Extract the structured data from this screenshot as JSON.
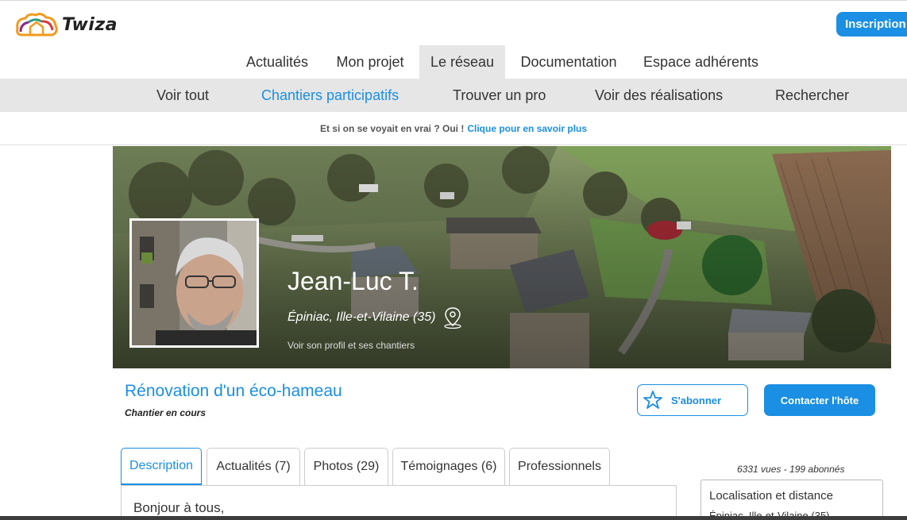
{
  "header": {
    "logo_text": "Twiza",
    "signup_label": "Inscription"
  },
  "main_nav": [
    {
      "label": "Actualités",
      "active": false
    },
    {
      "label": "Mon projet",
      "active": false
    },
    {
      "label": "Le réseau",
      "active": true
    },
    {
      "label": "Documentation",
      "active": false
    },
    {
      "label": "Espace adhérents",
      "active": false
    }
  ],
  "sub_nav": [
    {
      "label": "Voir tout",
      "active": false
    },
    {
      "label": "Chantiers participatifs",
      "active": true
    },
    {
      "label": "Trouver un pro",
      "active": false
    },
    {
      "label": "Voir des réalisations",
      "active": false
    },
    {
      "label": "Rechercher",
      "active": false
    }
  ],
  "notice": {
    "text": "Et si on se voyait en vrai ? Oui !",
    "link": "Clique pour en savoir plus"
  },
  "host": {
    "name": "Jean-Luc T.",
    "location": "Épiniac, Ille-et-Vilaine (35)",
    "profile_link": "Voir son profil et ses chantiers"
  },
  "project": {
    "title": "Rénovation d'un éco-hameau",
    "status": "Chantier en cours",
    "subscribe_label": "S'abonner",
    "contact_label": "Contacter l'hôte"
  },
  "tabs": [
    {
      "label": "Description",
      "active": true
    },
    {
      "label": "Actualités (7)",
      "active": false
    },
    {
      "label": "Photos (29)",
      "active": false
    },
    {
      "label": "Témoignages (6)",
      "active": false
    },
    {
      "label": "Professionnels",
      "active": false
    }
  ],
  "content": {
    "intro": "Bonjour à tous,"
  },
  "side": {
    "stats": "6331 vues - 199 abonnés",
    "box_title": "Localisation et distance",
    "box_sub": "Épiniac, Ille-et-Vilaine (35)"
  },
  "colors": {
    "accent": "#1a8fe3",
    "nav_active_bg": "#e6e6e6"
  }
}
